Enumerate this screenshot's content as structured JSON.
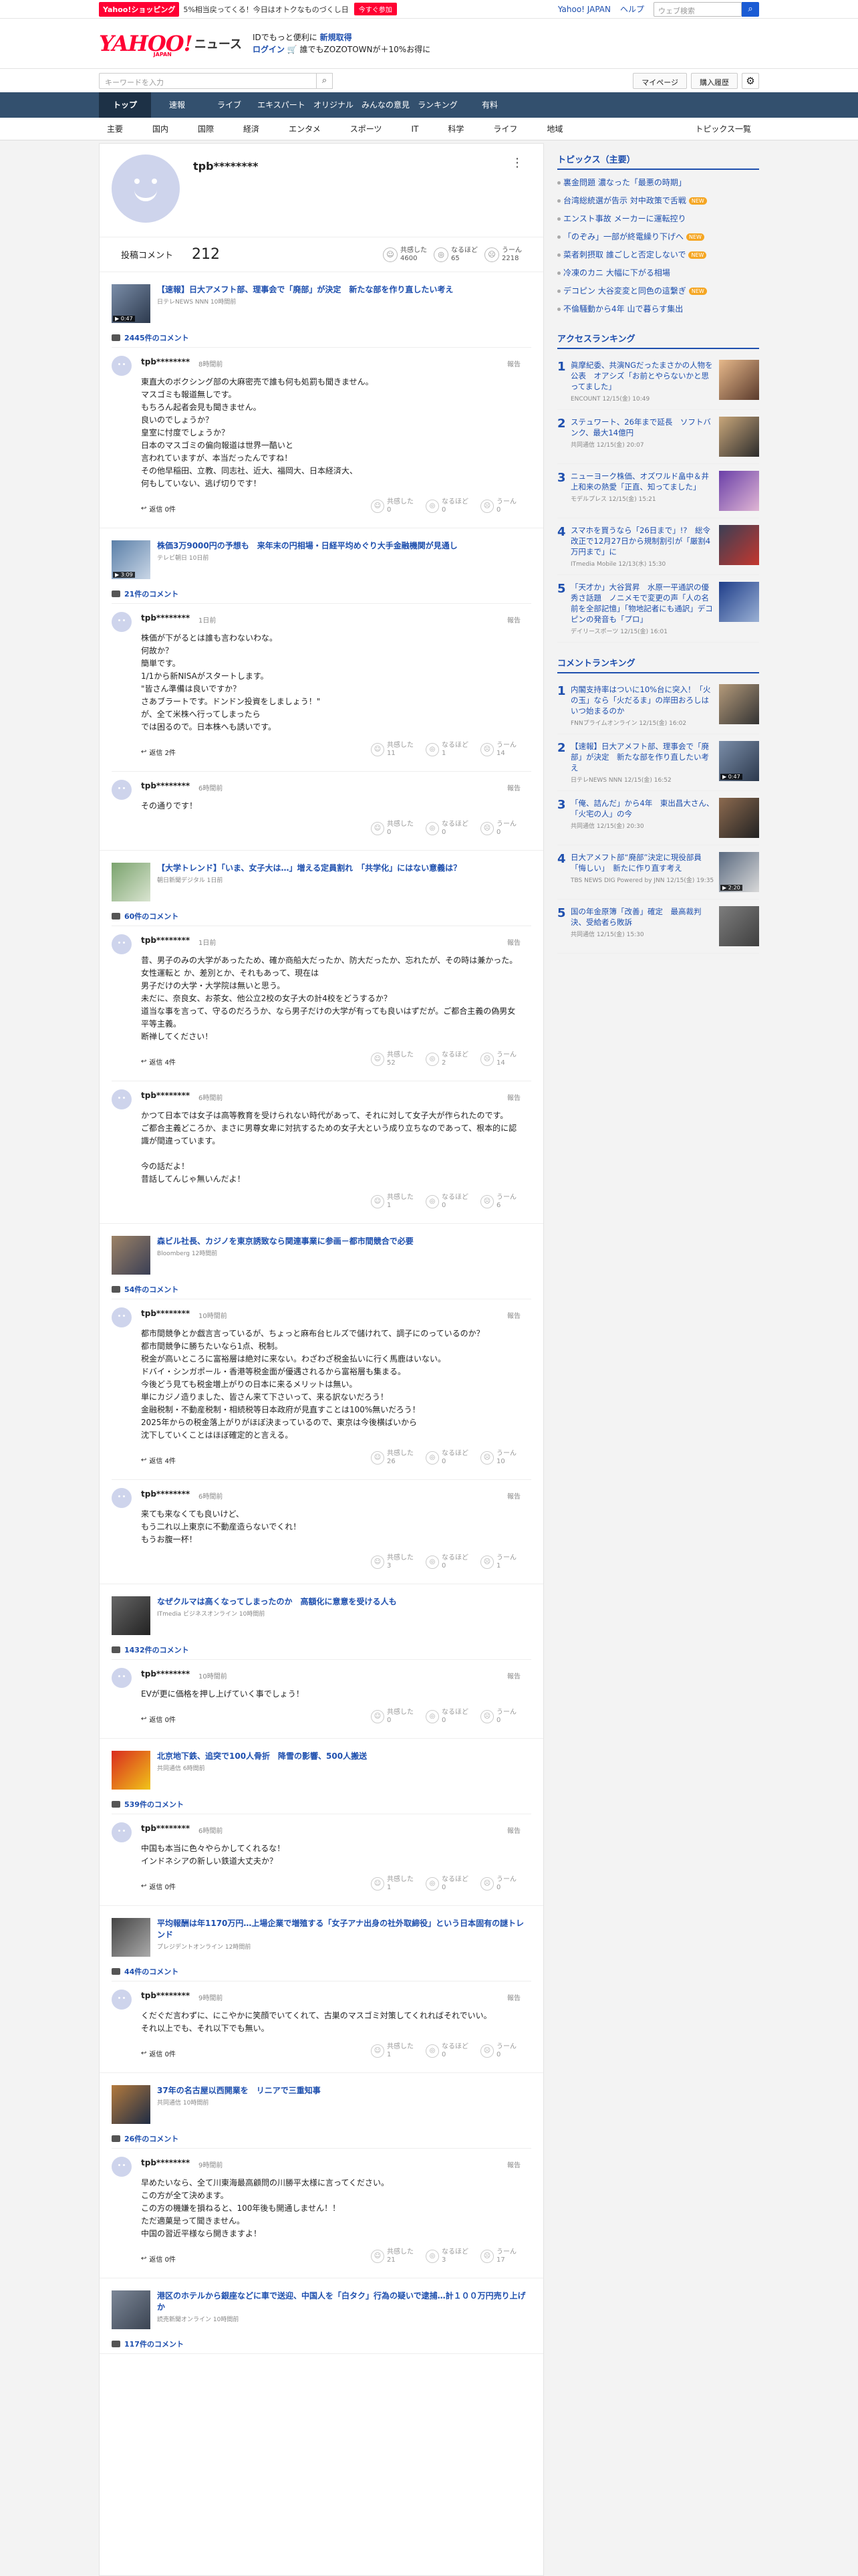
{
  "promo": {
    "shop": "Yahoo!ショッピング",
    "msg": "5%相当戻ってくる！今日はオトクなものづくし日",
    "now": "今すぐ参加",
    "yj": "Yahoo! JAPAN",
    "help": "ヘルプ",
    "search_ph": "ウェブ検索"
  },
  "mast": {
    "logo": "YAHOO!",
    "logo_jp": "JAPAN",
    "news": "ニュース",
    "ad1_a": "IDでもっと便利に",
    "ad1_b": "新規取得",
    "ad2_a": "ログイン",
    "ad2_b": "🛒 誰でもZOZOTOWNが＋10%お得に"
  },
  "search": {
    "placeholder": "キーワードを入力",
    "mypage": "マイページ",
    "purchase": "購入履歴"
  },
  "nav": [
    "トップ",
    "速報",
    "ライブ",
    "エキスパート",
    "オリジナル",
    "みんなの意見",
    "ランキング",
    "有料"
  ],
  "subnav": [
    "主要",
    "国内",
    "国際",
    "経済",
    "エンタメ",
    "スポーツ",
    "IT",
    "科学",
    "ライフ",
    "地域"
  ],
  "subnav_topics": "トピックス一覧",
  "profile": {
    "name": "tpb********",
    "posts_label": "投稿コメント",
    "posts": "212",
    "r1_l": "共感した",
    "r1_v": "4600",
    "r2_l": "なるほど",
    "r2_v": "65",
    "r3_l": "うーん",
    "r3_v": "2218"
  },
  "labels": {
    "report": "報告",
    "reply": "返信",
    "agree": "共感した",
    "naruhodo": "なるほど",
    "uun": "うーん"
  },
  "articles": [
    {
      "title": "【速報】日大アメフト部、理事会で「廃部」が決定　新たな部を作り直したい考え",
      "src": "日テレNEWS NNN 10時間前",
      "vid": "▶ 0:47",
      "count": "2445件のコメント",
      "thumb": [
        "#7a8da8",
        "#2d3a4e"
      ],
      "comments": [
        {
          "name": "tpb********",
          "time": "8時間前",
          "body": "東直大のボクシング部の大麻密売で誰も何も処罰も聞きません。\nマスゴミも報道無しです。\nもちろん起者会見も聞きません。\n良いのでしょうか？\n皇室に忖度でしょうか？\n日本のマスゴミの偏向報道は世界一酷いと\n言われていますが、本当だったんですね！\nその他早稲田、立教、同志社、近大、福岡大、日本経済大、\n何もしていない、逃げ切りです！",
          "reply": "返信 0件",
          "a": "0",
          "b": "0",
          "c": "0"
        }
      ]
    },
    {
      "title": "株価3万9000円の予想も　来年末の円相場・日経平均めぐり大手金融機関が見通し",
      "src": "テレビ朝日 10日前",
      "vid": "▶ 3:09",
      "count": "21件のコメント",
      "thumb": [
        "#5a7fa8",
        "#c9d6e6"
      ],
      "comments": [
        {
          "name": "tpb********",
          "time": "1日前",
          "body": "株価が下がるとは誰も言わないわな。\n何故か？\n簡単です。\n1/1から新NISAがスタートします。\n\"皆さん準備は良いですか？\n さあブラートです。ドンドン投資をしましょう！\"\nが、全て米株へ行ってしまったら\nでは困るので。日本株へも誘いです。",
          "reply": "返信 2件",
          "a": "11",
          "b": "1",
          "c": "14"
        },
        {
          "name": "tpb********",
          "time": "6時間前",
          "body": "その通りです！",
          "reply": "",
          "a": "0",
          "b": "0",
          "c": "0"
        }
      ]
    },
    {
      "title": "【大学トレンド】「いま、女子大は…」増える定員割れ　「共学化」にはない意義は？",
      "src": "朝日新聞デジタル 1日前",
      "vid": "",
      "count": "60件のコメント",
      "thumb": [
        "#7aa36d",
        "#d9e4d0"
      ],
      "comments": [
        {
          "name": "tpb********",
          "time": "1日前",
          "body": "昔、男子のみの大学があったため、確か商船大だったか、防大だったか、忘れたが、その時は兼かった。女性運転と か、差別とか、それもあって、現在は\n男子だけの大学・大学院は無いと思う。\n未だに、奈良女、お茶女、他公立2校の女子大の計4校をどうするか？\n道当な事を言って、守るのだろうか、なら男子だけの大学が有っても良いはずだが。ご都合主義の偽男女平等主義。\n断禅してください！",
          "reply": "返信 4件",
          "a": "52",
          "b": "2",
          "c": "14"
        },
        {
          "name": "tpb********",
          "time": "6時間前",
          "body": "かつて日本では女子は高等教育を受けられない時代があって、それに対して女子大が作られたのです。\nご都合主義どころか、まさに男尊女卑に対抗するための女子大という成り立ちなのであって、根本的に認識が間違っています。\n\n今の話だよ！\n昔話してんじゃ無いんだよ！",
          "reply": "",
          "a": "1",
          "b": "0",
          "c": "6"
        }
      ]
    },
    {
      "title": "森ビル社長、カジノを東京誘致なら関連事業に参画－都市間競合で必要",
      "src": "Bloomberg 12時間前",
      "vid": "",
      "count": "54件のコメント",
      "thumb": [
        "#9c8266",
        "#3a3f55"
      ],
      "comments": [
        {
          "name": "tpb********",
          "time": "10時間前",
          "body": "都市間競争とか戯言言っているが、ちょっと麻布台ヒルズで儲けれて、調子にのっているのか？\n都市間競争に勝ちたいなら1点、税制。\n税金が高いところに富裕層は絶対に来ない。わざわざ税金払いに行く馬鹿はいない。\nドバイ・シンガポール・香港等税金面が優遇されるから富裕層も集まる。\n今後どう見ても税金増上がりの日本に来るメリットは無い。\n単にカジノ造りました、皆さん来て下さいって、来る訳ないだろう！\n金融税制・不動産税制・相続税等日本政府が見直すことは100%無いだろう！\n2025年からの税金落上がりがほぼ決まっているので、東京は今後横ばいから\n沈下していくことはほぼ確定的と言える。",
          "reply": "返信 4件",
          "a": "26",
          "b": "0",
          "c": "10"
        },
        {
          "name": "tpb********",
          "time": "6時間前",
          "body": "来ても来なくても良いけど、\nもう二れ以上東京に不動産造らないでくれ！\nもうお腹一杯！",
          "reply": "",
          "a": "3",
          "b": "0",
          "c": "1"
        }
      ]
    },
    {
      "title": "なぜクルマは高くなってしまったのか　高額化に意意を受ける人も",
      "src": "ITmedia ビジネスオンライン 10時間前",
      "vid": "",
      "count": "1432件のコメント",
      "thumb": [
        "#666",
        "#222"
      ],
      "comments": [
        {
          "name": "tpb********",
          "time": "10時間前",
          "body": "EVが更に価格を押し上げていく事でしょう！",
          "reply": "返信 0件",
          "a": "0",
          "b": "0",
          "c": "0"
        }
      ]
    },
    {
      "title": "北京地下鉄、追突で100人骨折　降雪の影響、500人搬送",
      "src": "共同通信 6時間前",
      "vid": "",
      "count": "539件のコメント",
      "thumb": [
        "#d92b1f",
        "#f0c419"
      ],
      "comments": [
        {
          "name": "tpb********",
          "time": "6時間前",
          "body": "中国も本当に色々やらかしてくれるな！\nインドネシアの新しい鉄道大丈夫か？",
          "reply": "返信 0件",
          "a": "1",
          "b": "0",
          "c": "0"
        }
      ]
    },
    {
      "title": "平均報酬は年1170万円…上場企業で増殖する「女子アナ出身の社外取締役」という日本固有の謎トレンド",
      "src": "プレジデントオンライン 12時間前",
      "vid": "",
      "count": "44件のコメント",
      "thumb": [
        "#444",
        "#aaa"
      ],
      "comments": [
        {
          "name": "tpb********",
          "time": "9時間前",
          "body": "くだぐだ言わずに、にこやかに笑顔でいてくれて、古巣のマスゴミ対策してくれればそれでいい。\nそれ以上でも、それ以下でも無い。",
          "reply": "返信 0件",
          "a": "1",
          "b": "0",
          "c": "0"
        }
      ]
    },
    {
      "title": "37年の名古屋以西開業を　リニアで三重知事",
      "src": "共同通信 10時間前",
      "vid": "",
      "count": "26件のコメント",
      "thumb": [
        "#b37a3d",
        "#1f2c44"
      ],
      "comments": [
        {
          "name": "tpb********",
          "time": "9時間前",
          "body": "早めたいなら、全て川東海最高顧問の川勝平太様に言ってください。\nこの方が全て決めます。\nこの方の機嫌を損ねると、100年後も開通しません！！\nただ適菓是って聞きません。\n中国の習近平様なら開きますよ！",
          "reply": "返信 0件",
          "a": "21",
          "b": "3",
          "c": "17"
        }
      ]
    },
    {
      "title": "港区のホテルから銀座などに車で送迎、中国人を「白タク」行為の疑いで逮捕…計１００万円売り上げか",
      "src": "読売新聞オンライン 10時間前",
      "vid": "",
      "count": "117件のコメント",
      "thumb": [
        "#7c8797",
        "#3b4452"
      ],
      "comments": []
    }
  ],
  "side": {
    "topics_head": "トピックス（主要）",
    "topics": [
      {
        "t": "裏金問題 濃なった「最悪の時期」",
        "n": false
      },
      {
        "t": "台湾総統選が告示 対中政策で舌戦",
        "n": true
      },
      {
        "t": "エンスト事故 メーカーに運転控り",
        "n": false
      },
      {
        "t": "「のぞみ」一部が終電繰り下げへ",
        "n": true
      },
      {
        "t": "菜者刺摂取 誰ごしと否定しないで",
        "n": true
      },
      {
        "t": "冷凍のカニ 大幅に下がる相場",
        "n": false
      },
      {
        "t": "デコピン 大谷変変と同色の這繋ぎ",
        "n": true
      },
      {
        "t": "不倫騒動から4年 山で暮らす集出",
        "n": false
      }
    ],
    "new": "NEW",
    "access_head": "アクセスランキング",
    "access": [
      {
        "t": "眞摩紀委、共演NGだったまさかの人物を公表　オアシズ「お前とやらないかと思ってました」",
        "s": "ENCOUNT 12/15(金) 10:49",
        "c": [
          "#e6b88a",
          "#5a3a2c"
        ]
      },
      {
        "t": "ステュワート、26年まで延長　ソフトバンク、最大14億円",
        "s": "共同通信 12/15(金) 20:07",
        "c": [
          "#c8a67a",
          "#2c2c2c"
        ]
      },
      {
        "t": "ニューヨーク株価、オズワルド畠中＆井上和来の熱愛「正直、知ってました」",
        "s": "モデルプレス 12/15(金) 15:21",
        "c": [
          "#6a3fa8",
          "#e0b6d4"
        ]
      },
      {
        "t": "スマホを買うなら「26日まで」!?　総令改正で12月27日から規制割引が「厳割4万円まで」に",
        "s": "ITmedia Mobile 12/13(水) 15:30",
        "c": [
          "#3a3f55",
          "#c4372e"
        ]
      },
      {
        "t": "「天才か」大谷賞昇　水原一平通訳の優秀さ話題　ノニメモで変更の声「人の名前を全部記憶」「物地記者にも通訳」デコピンの発音も「プロ」",
        "s": "デイリースポーツ 12/15(金) 16:01",
        "c": [
          "#1f3e8a",
          "#9ab0d4"
        ]
      }
    ],
    "comment_head": "コメントランキング",
    "comments": [
      {
        "t": "内閣支持率はついに10%台に突入！「火の玉」なら「火だるま」の岸田おろしはいつ始まるのか",
        "s": "FNNプライムオンライン 12/15(金) 16:02",
        "c": [
          "#b49a7a",
          "#333"
        ],
        "v": ""
      },
      {
        "t": "【速報】日大アメフト部、理事会で「廃部」が決定　新たな部を作り直したい考え",
        "s": "日テレNEWS NNN 12/15(金) 16:52",
        "c": [
          "#7a8da8",
          "#2d3a4e"
        ],
        "v": "▶ 0:47"
      },
      {
        "t": "「俺、詰んだ」から4年　東出昌大さん、「火宅の人」の今",
        "s": "共同通信 12/15(金) 20:30",
        "c": [
          "#8c6a4f",
          "#222"
        ],
        "v": ""
      },
      {
        "t": "日大アメフト部“廃部”決定に現役部員「悔しい」　新たに作り直す考え",
        "s": "TBS NEWS DIG Powered by JNN 12/15(金) 19:35",
        "c": [
          "#5a6a80",
          "#d8d8d8"
        ],
        "v": "▶ 2:20"
      },
      {
        "t": "国の年金原簿「改善」確定　最高裁判決、受給者ら敗訴",
        "s": "共同通信 12/15(金) 15:30",
        "c": [
          "#7d7d7d",
          "#3f3f3f"
        ],
        "v": ""
      }
    ]
  }
}
